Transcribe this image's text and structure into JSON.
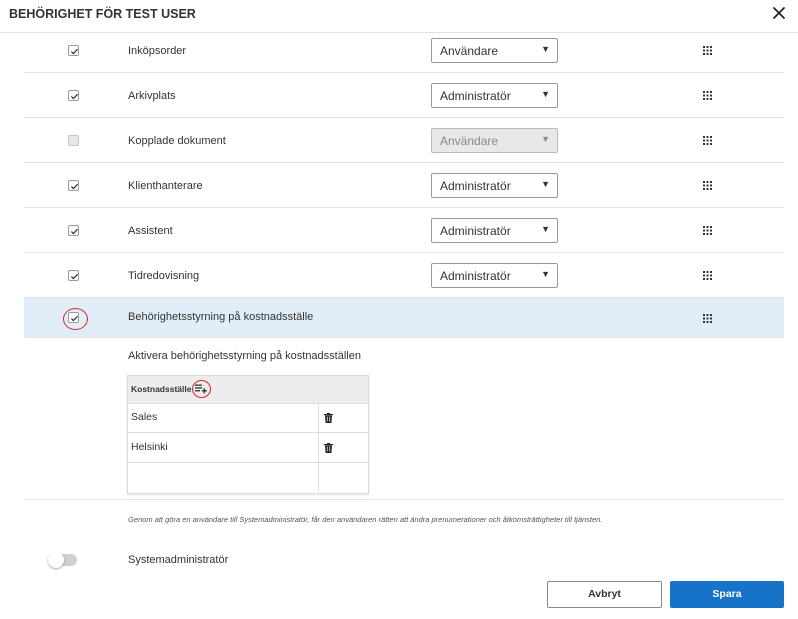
{
  "dialog": {
    "title": "BEHÖRIGHET FÖR TEST USER"
  },
  "permissions": [
    {
      "label": "Inköpsorder",
      "role": "Användare",
      "checked": true,
      "disabled": false
    },
    {
      "label": "Arkivplats",
      "role": "Administratör",
      "checked": true,
      "disabled": false
    },
    {
      "label": "Kopplade dokument",
      "role": "Användare",
      "checked": false,
      "disabled": true
    },
    {
      "label": "Klienthanterare",
      "role": "Administratör",
      "checked": true,
      "disabled": false
    },
    {
      "label": "Assistent",
      "role": "Administratör",
      "checked": true,
      "disabled": false
    },
    {
      "label": "Tidredovisning",
      "role": "Administratör",
      "checked": true,
      "disabled": false
    }
  ],
  "cost_center": {
    "label": "Behörighetsstyrning på kostnadsställe",
    "checked": true,
    "subtext": "Aktivera behörighetsstyrning på kostnadsställen",
    "table_header": "Kostnadsställe",
    "rows": [
      "Sales",
      "Helsinki",
      ""
    ]
  },
  "note": "Genom att göra en användare till Systemadministratör, får den användaren rätten att ändra prenumerationer och åtkomsträttigheter till tjänsten.",
  "sysadmin": {
    "label": "Systemadministratör",
    "enabled": false
  },
  "buttons": {
    "cancel": "Avbryt",
    "save": "Spara"
  },
  "colors": {
    "primary": "#1673c8",
    "highlight_row": "#e2eef7",
    "annotation_red": "#d8242a"
  }
}
